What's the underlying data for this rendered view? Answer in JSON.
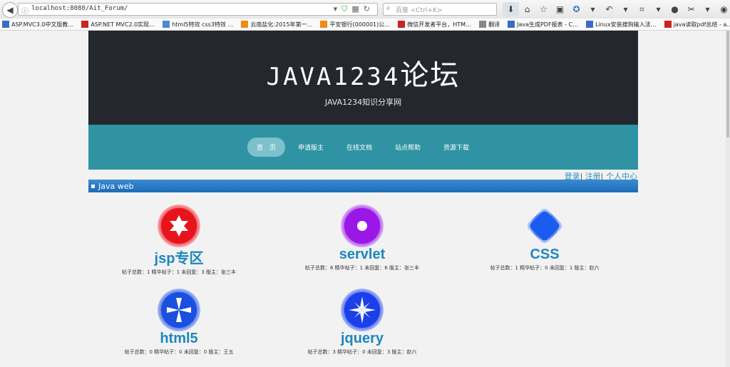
{
  "browser": {
    "url": "localhost:8080/Ait_Forum/",
    "search_placeholder": "百度 <Ctrl+K>",
    "bookmarks": [
      {
        "label": "ASP.MVC3.0中文版教…",
        "color": "#3b6cc4"
      },
      {
        "label": "ASP.NET MVC2.0实现…",
        "color": "#cc2222"
      },
      {
        "label": "html5特效 css3特效 …",
        "color": "#4a8ad0"
      },
      {
        "label": "云南盐化:2015年第一…",
        "color": "#f08a18"
      },
      {
        "label": "平安银行(000001)公…",
        "color": "#f08a18"
      },
      {
        "label": "微信开发者平台，HTM…",
        "color": "#cc2222"
      },
      {
        "label": "翻译",
        "color": "#888888"
      },
      {
        "label": "Java生成PDF报表 - C…",
        "color": "#3b6cc4"
      },
      {
        "label": "Linux安装搜狗输入法…",
        "color": "#3b6cc4"
      },
      {
        "label": "java读取pdf总结 - a…",
        "color": "#cc2222"
      }
    ]
  },
  "header": {
    "logo_latin": "JAVA1234",
    "logo_cn": "论坛",
    "subtitle": "JAVA1234知识分享网"
  },
  "nav": {
    "items": [
      "首　页",
      "申请版主",
      "在线文档",
      "站点帮助",
      "资源下载"
    ]
  },
  "userlinks": {
    "login": "登录",
    "sep1": "|",
    "register": "注册",
    "sep2": "|",
    "profile": "个人中心"
  },
  "section": {
    "title": "Java web"
  },
  "boards": [
    {
      "name": "jsp专区",
      "stats": "帖子总数：1 精华帖子：1 未回复：3 版主：张三丰",
      "icon": "star-icon",
      "color": "#e8141c"
    },
    {
      "name": "servlet",
      "stats": "帖子总数：6 精华帖子：1 未回复：6 版主：张三丰",
      "icon": "ring-icon",
      "color": "#9b17e6"
    },
    {
      "name": "CSS",
      "stats": "帖子总数：1 精华帖子：0 未回复：1 版主：赵六",
      "icon": "diamond-icon",
      "color": "#1b5cf0"
    },
    {
      "name": "html5",
      "stats": "帖子总数：0 精华帖子：0 未回复：0 版主：王五",
      "icon": "pinwheel-icon",
      "color": "#1b4fe0"
    },
    {
      "name": "jquery",
      "stats": "帖子总数：3 精华帖子：0 未回复：3 版主：赵六",
      "icon": "spark-icon",
      "color": "#1b3fe8"
    }
  ]
}
